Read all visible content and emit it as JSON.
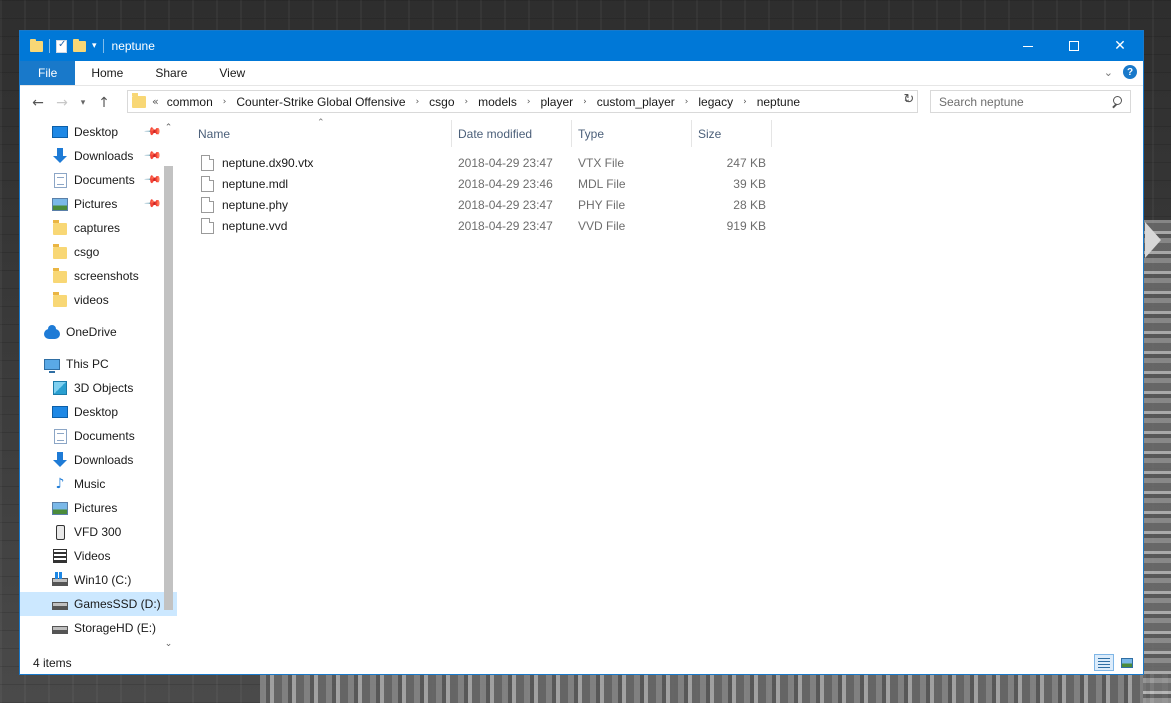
{
  "window": {
    "title": "neptune"
  },
  "ribbon": {
    "tabs": [
      "File",
      "Home",
      "Share",
      "View"
    ]
  },
  "address": {
    "overflow": "«",
    "crumbs": [
      "common",
      "Counter-Strike Global Offensive",
      "csgo",
      "models",
      "player",
      "custom_player",
      "legacy",
      "neptune"
    ]
  },
  "search": {
    "placeholder": "Search neptune"
  },
  "nav": {
    "quick_access": [
      {
        "label": "Desktop",
        "icon": "desktop-icon",
        "pinned": true
      },
      {
        "label": "Downloads",
        "icon": "downloads-icon",
        "pinned": true
      },
      {
        "label": "Documents",
        "icon": "documents-icon",
        "pinned": true
      },
      {
        "label": "Pictures",
        "icon": "pictures-icon",
        "pinned": true
      },
      {
        "label": "captures",
        "icon": "folder-icon",
        "pinned": false
      },
      {
        "label": "csgo",
        "icon": "folder-icon",
        "pinned": false
      },
      {
        "label": "screenshots",
        "icon": "folder-icon",
        "pinned": false
      },
      {
        "label": "videos",
        "icon": "folder-icon",
        "pinned": false
      }
    ],
    "onedrive": "OneDrive",
    "this_pc": "This PC",
    "pc_items": [
      {
        "label": "3D Objects",
        "icon": "3d-objects-icon"
      },
      {
        "label": "Desktop",
        "icon": "desktop-icon"
      },
      {
        "label": "Documents",
        "icon": "documents-icon"
      },
      {
        "label": "Downloads",
        "icon": "downloads-icon"
      },
      {
        "label": "Music",
        "icon": "music-icon"
      },
      {
        "label": "Pictures",
        "icon": "pictures-icon"
      },
      {
        "label": "VFD 300",
        "icon": "phone-icon"
      },
      {
        "label": "Videos",
        "icon": "videos-icon"
      },
      {
        "label": "Win10 (C:)",
        "icon": "windows-drive-icon"
      },
      {
        "label": "GamesSSD (D:)",
        "icon": "drive-icon",
        "selected": true
      },
      {
        "label": "StorageHD (E:)",
        "icon": "drive-icon"
      }
    ]
  },
  "columns": {
    "name": "Name",
    "date": "Date modified",
    "type": "Type",
    "size": "Size"
  },
  "files": [
    {
      "name": "neptune.dx90.vtx",
      "date": "2018-04-29 23:47",
      "type": "VTX File",
      "size": "247 KB"
    },
    {
      "name": "neptune.mdl",
      "date": "2018-04-29 23:46",
      "type": "MDL File",
      "size": "39 KB"
    },
    {
      "name": "neptune.phy",
      "date": "2018-04-29 23:47",
      "type": "PHY File",
      "size": "28 KB"
    },
    {
      "name": "neptune.vvd",
      "date": "2018-04-29 23:47",
      "type": "VVD File",
      "size": "919 KB"
    }
  ],
  "status": {
    "count": "4 items"
  },
  "colors": {
    "titlebar": "#0078d7",
    "selection": "#cce8ff",
    "folder": "#f8d775"
  }
}
